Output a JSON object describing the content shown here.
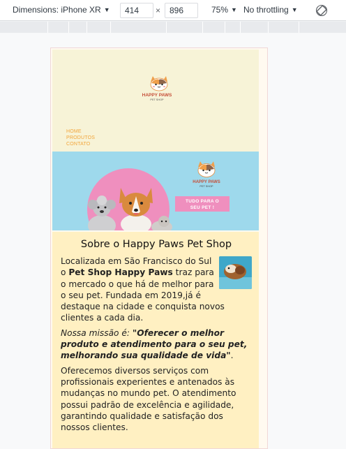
{
  "devtools": {
    "dimensions_label": "Dimensions: iPhone XR",
    "width_value": "414",
    "separator": "×",
    "height_value": "896",
    "zoom": "75%",
    "throttling": "No throttling"
  },
  "site": {
    "logo_text": "HAPPY PAWS",
    "logo_sub": "PET SHOP",
    "nav": [
      "HOME",
      "PRODUTOS",
      "CONTATO"
    ],
    "banner": {
      "logo_text": "HAPPY PAWS",
      "logo_sub": "PET SHOP",
      "cta_line1": "TUDO PARA O",
      "cta_line2": "SEU PET !"
    },
    "about": {
      "title": "Sobre o Happy Paws Pet Shop",
      "p1_before": "Localizada em São Francisco do Sul o ",
      "p1_bold": "Pet Shop Happy Paws",
      "p1_after": " traz para o mercado o que há de melhor para o seu pet. Fundada em 2019,já é destaque na cidade e conquista novos clientes a cada dia.",
      "mission_lead": "Nossa missão é: ",
      "mission_quote": "\"Oferecer o melhor produto e atendimento para o seu pet, melhorando sua qualidade de vida\"",
      "mission_end": ".",
      "p3": "Oferecemos diversos serviços com profissionais experientes e antenados às mudanças no mundo pet. O atendimento possui padrão de excelência e agilidade, garantindo qualidade e satisfação dos nossos clientes."
    }
  },
  "colors": {
    "header_bg": "#f7f3d7",
    "nav_text": "#f2a53a",
    "banner_bg": "#9ed9ec",
    "accent_pink": "#ef8fbe",
    "about_bg": "#fff0c2"
  }
}
